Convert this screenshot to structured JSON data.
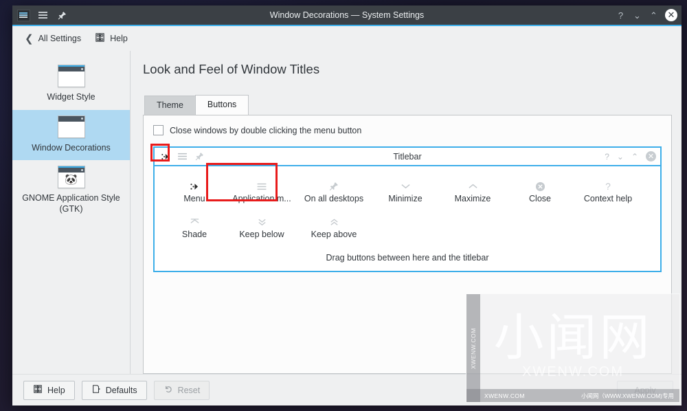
{
  "window": {
    "title": "Window Decorations — System Settings",
    "titlebar_left_icons": [
      "app-icon",
      "menu-icon",
      "keep-above-pin-icon"
    ],
    "controls": {
      "context_help": "?",
      "minimize": "⌄",
      "maximize": "⌃",
      "close": "✕"
    }
  },
  "toolbar": {
    "back_label": "All Settings",
    "back_icon": "chevron-left-icon",
    "help_label": "Help",
    "help_icon": "help-book-icon"
  },
  "sidebar": {
    "items": [
      {
        "label": "Widget Style",
        "icon": "window-preview-icon",
        "selected": false
      },
      {
        "label": "Window Decorations",
        "icon": "window-preview-icon",
        "selected": true
      },
      {
        "label": "GNOME Application Style (GTK)",
        "icon": "gnome-window-icon",
        "selected": false
      }
    ]
  },
  "main": {
    "page_title": "Look and Feel of Window Titles",
    "tabs": [
      {
        "label": "Theme",
        "active": false
      },
      {
        "label": "Buttons",
        "active": true
      }
    ],
    "checkbox": {
      "label": "Close windows by double clicking the menu button",
      "checked": false
    },
    "preview": {
      "titlebar_title": "Titlebar",
      "titlebar_left_buttons": [
        {
          "name": "menu-button",
          "glyph": "⁘",
          "dark": true
        },
        {
          "name": "application-menu-button",
          "glyph": "☰",
          "dark": false
        },
        {
          "name": "keep-above-button",
          "glyph": "pin",
          "dark": false
        }
      ],
      "titlebar_right_buttons": [
        {
          "name": "context-help-button",
          "glyph": "?"
        },
        {
          "name": "minimize-button",
          "glyph": "⌄"
        },
        {
          "name": "maximize-button",
          "glyph": "⌃"
        },
        {
          "name": "close-button",
          "glyph": "✕"
        }
      ],
      "available_buttons_row1": [
        {
          "label": "Menu",
          "icon": "menu-dots-icon",
          "dark": true
        },
        {
          "label": "Application m...",
          "icon": "hamburger-icon",
          "dark": false
        },
        {
          "label": "On all desktops",
          "icon": "pin-icon",
          "dark": false
        },
        {
          "label": "Minimize",
          "icon": "chevron-down-icon",
          "dark": false
        },
        {
          "label": "Maximize",
          "icon": "chevron-up-icon",
          "dark": false
        },
        {
          "label": "Close",
          "icon": "close-circle-icon",
          "dark": false
        },
        {
          "label": "Context help",
          "icon": "question-mark-icon",
          "dark": false
        }
      ],
      "available_buttons_row2": [
        {
          "label": "Shade",
          "icon": "shade-icon",
          "dark": false
        },
        {
          "label": "Keep below",
          "icon": "double-chevron-down-icon",
          "dark": false
        },
        {
          "label": "Keep above",
          "icon": "double-chevron-up-icon",
          "dark": false
        }
      ],
      "drag_hint": "Drag buttons between here and the titlebar"
    }
  },
  "bottom_bar": {
    "help_label": "Help",
    "help_icon": "help-book-icon",
    "defaults_label": "Defaults",
    "defaults_icon": "document-revert-icon",
    "reset_label": "Reset",
    "reset_icon": "undo-arrow-icon",
    "reset_disabled": true,
    "apply_label": "Apply",
    "apply_disabled": true
  },
  "watermark": {
    "big_text": "小闻网",
    "sub_text": "XWENW.COM",
    "side_text": "XWENW.COM",
    "footer_left": "XWENW.COM",
    "footer_right": "小闻网（WWW.XWENW.COM)专用"
  },
  "colors": {
    "accent": "#3daee9",
    "titlebar_bg": "#3b4045",
    "window_bg": "#eff0f1",
    "selection": "#afd9f2",
    "annotation_red": "#e81b1b"
  }
}
